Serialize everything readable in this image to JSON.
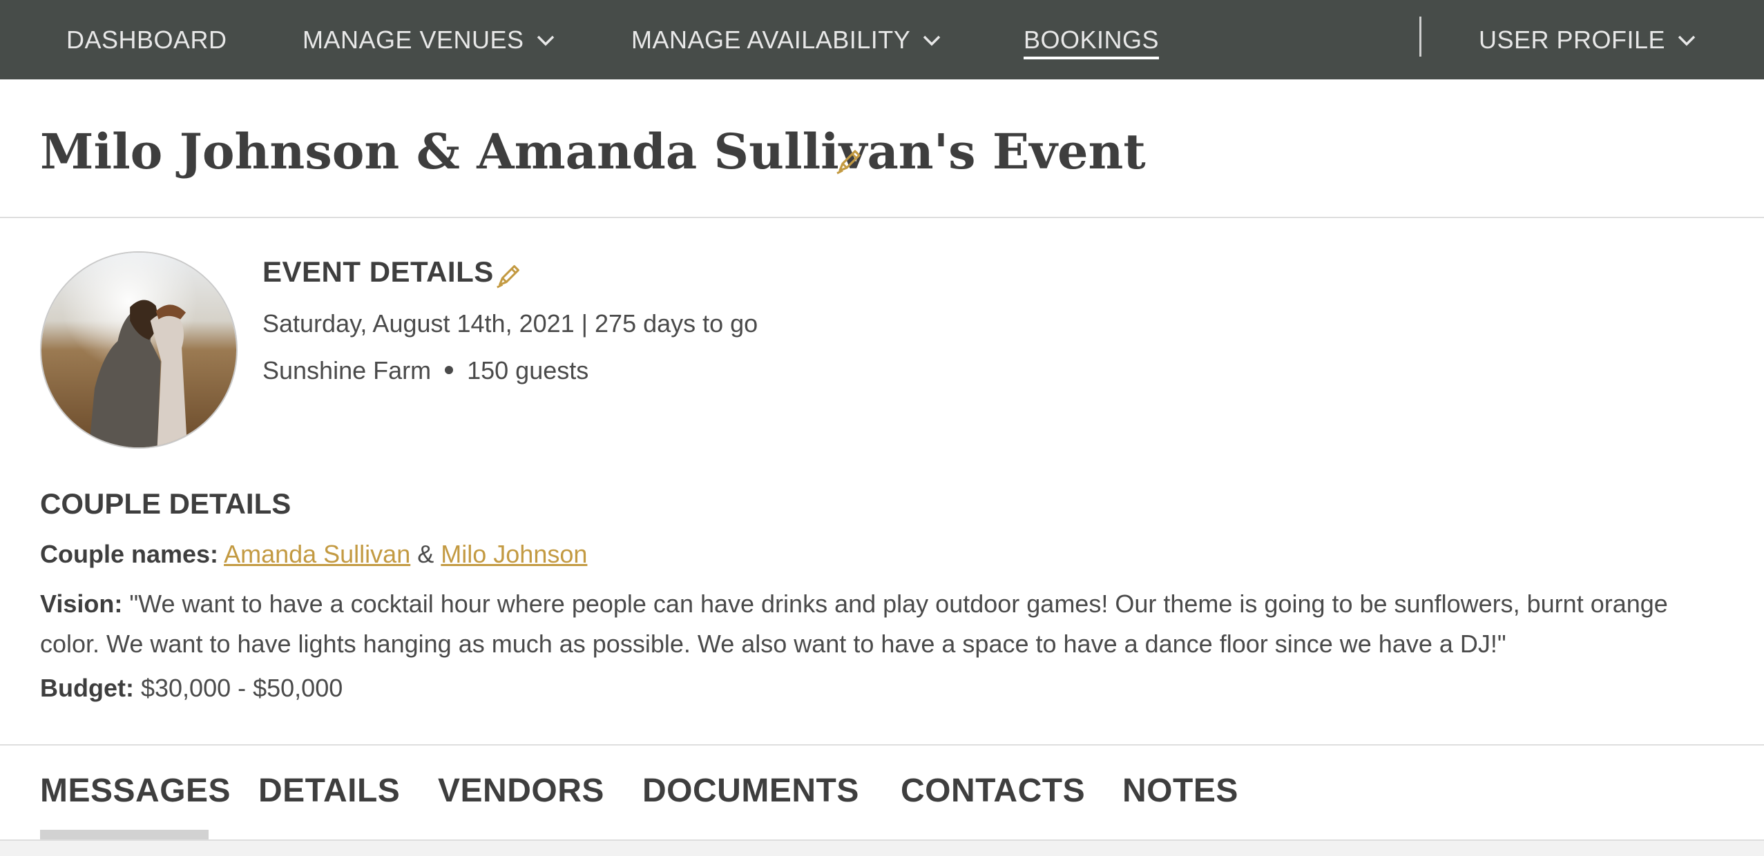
{
  "nav": {
    "dashboard": "DASHBOARD",
    "manage_venues": "MANAGE VENUES",
    "manage_availability": "MANAGE AVAILABILITY",
    "bookings": "BOOKINGS",
    "user_profile": "USER PROFILE"
  },
  "page": {
    "title": "Milo Johnson & Amanda Sullivan's Event"
  },
  "event_details": {
    "heading": "EVENT DETAILS",
    "date_line": "Saturday, August 14th, 2021 | 275 days to go",
    "venue": "Sunshine Farm",
    "guests": "150 guests"
  },
  "couple_details": {
    "heading": "COUPLE DETAILS",
    "names_label": "Couple names:",
    "name1": "Amanda Sullivan",
    "amp": "&",
    "name2": "Milo Johnson",
    "vision_label": "Vision:",
    "vision_text": "\"We want to have a cocktail hour where people can have drinks and play outdoor games! Our theme is going to be sunflowers, burnt orange color. We want to have lights hanging as much as possible. We also want to have a space to have a dance floor since we have a DJ!\"",
    "budget_label": "Budget:",
    "budget_value": "$30,000 - $50,000"
  },
  "tabs": [
    {
      "label": "MESSAGES",
      "active": true
    },
    {
      "label": "DETAILS",
      "active": false
    },
    {
      "label": "VENDORS",
      "active": false
    },
    {
      "label": "DOCUMENTS",
      "active": false
    },
    {
      "label": "CONTACTS",
      "active": false
    },
    {
      "label": "NOTES",
      "active": false
    }
  ],
  "colors": {
    "nav_bg": "#474c49",
    "accent_gold": "#c39a42",
    "text": "#4a4a4a"
  },
  "icons": {
    "edit": "pencil-icon",
    "dropdown": "chevron-down-icon"
  }
}
